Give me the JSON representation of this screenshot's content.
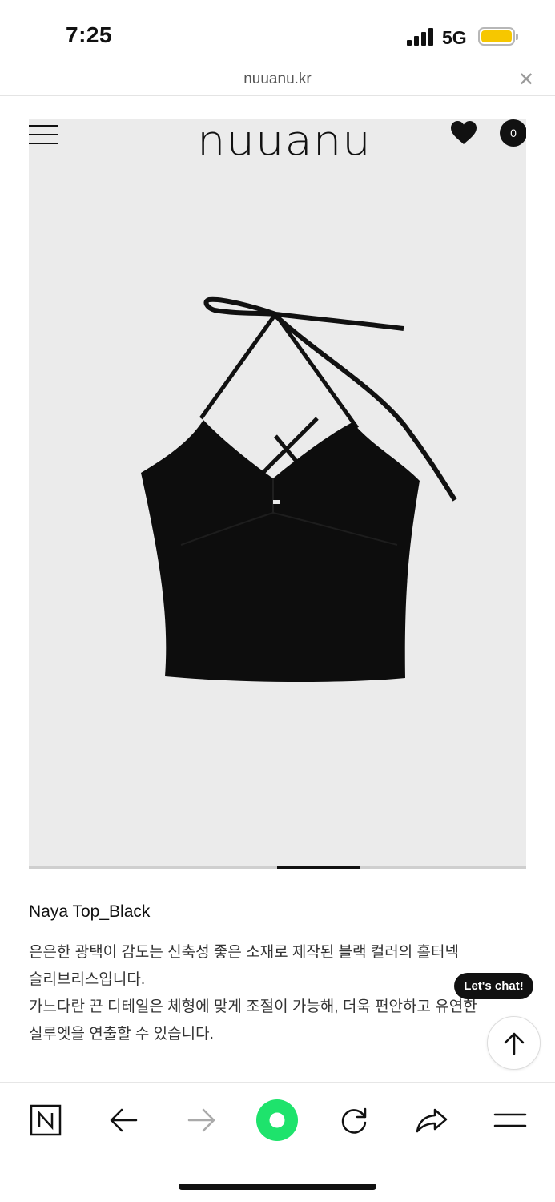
{
  "status_bar": {
    "time": "7:25",
    "network": "5G",
    "battery_color": "#f6c700",
    "icons": [
      "signal-icon",
      "battery-icon"
    ]
  },
  "url_bar": {
    "url": "nuuanu.kr",
    "close_icon": "close-icon"
  },
  "site_header": {
    "logo_text": "nuuanu",
    "menu_icon": "hamburger-menu-icon",
    "wishlist_icon": "heart-icon",
    "cart_count": "0"
  },
  "gallery": {
    "image": "black-halter-top-photo",
    "background_color": "#ebebeb",
    "active_slide_fraction": 0.5
  },
  "product": {
    "title": "Naya Top_Black",
    "description_lines": [
      "은은한 광택이 감도는 신축성 좋은 소재로 제작된 블랙 컬러의 홀터넥",
      "슬리브리스입니다.",
      "가느다란 끈 디테일은 체형에 맞게 조절이 가능해, 더욱 편안하고 유연한",
      "실루엣을 연출할 수 있습니다."
    ]
  },
  "floating": {
    "chat_label": "Let's chat!",
    "top_icon": "arrow-up-icon"
  },
  "toolbar": {
    "items": [
      "naver-home-icon",
      "back-arrow-icon",
      "forward-arrow-icon",
      "green-dot-icon",
      "refresh-icon",
      "share-icon",
      "menu-icon"
    ],
    "accent_color": "#1ee36c"
  }
}
